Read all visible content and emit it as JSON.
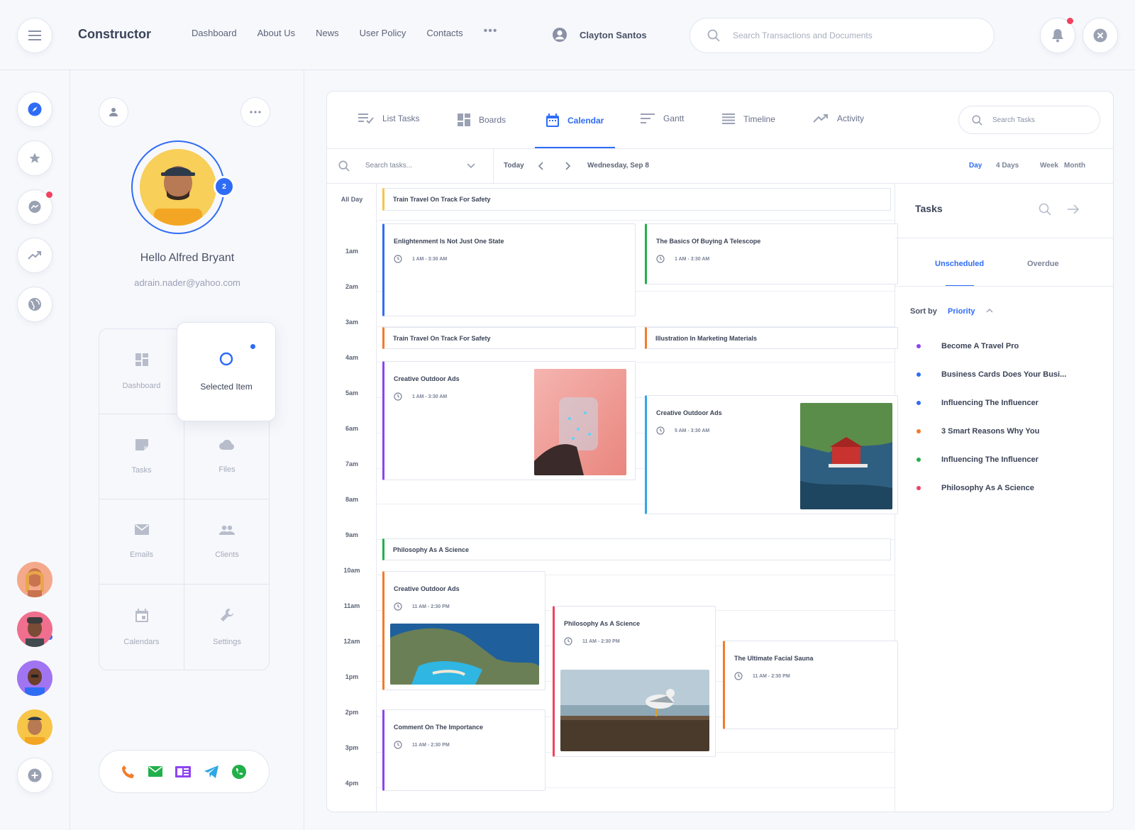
{
  "topbar": {
    "brand": "Constructor",
    "nav": [
      "Dashboard",
      "About Us",
      "News",
      "User Policy",
      "Contacts"
    ],
    "nav_more": "•••",
    "user_name": "Clayton Santos",
    "search_placeholder": "Search Transactions and Documents"
  },
  "profile": {
    "greeting": "Hello Alfred Bryant",
    "email": "adrain.nader@yahoo.com",
    "badge_count": "2",
    "menu": {
      "dashboard": "Dashboard",
      "selected": "Selected Item",
      "tasks": "Tasks",
      "files": "Files",
      "emails": "Emails",
      "clients": "Clients",
      "calendars": "Calendars",
      "settings": "Settings"
    }
  },
  "tabs": {
    "list_tasks": "List Tasks",
    "boards": "Boards",
    "calendar": "Calendar",
    "gantt": "Gantt",
    "timeline": "Timeline",
    "activity": "Activity",
    "search_placeholder": "Search Tasks"
  },
  "toolbar": {
    "search_placeholder": "Search tasks...",
    "today": "Today",
    "date": "Wednesday, Sep 8",
    "views": {
      "day": "Day",
      "four_days": "4 Days",
      "week": "Week",
      "month": "Month"
    }
  },
  "calendar": {
    "all_day_label": "All Day",
    "hours": [
      "1am",
      "2am",
      "3am",
      "4am",
      "5am",
      "6am",
      "7am",
      "8am",
      "9am",
      "10am",
      "11am",
      "12am",
      "1pm",
      "2pm",
      "3pm",
      "4pm"
    ],
    "all_day_event": "Train Travel On Track For Safety",
    "events": {
      "e1": {
        "title": "Enlightenment Is Not Just One State",
        "time": "1 AM - 3:30 AM"
      },
      "e2": {
        "title": "The Basics Of Buying A Telescope",
        "time": "1 AM - 3:30 AM"
      },
      "e3": {
        "title": "Train Travel On Track For Safety"
      },
      "e4": {
        "title": "Illustration In Marketing Materials"
      },
      "e5": {
        "title": "Creative Outdoor Ads",
        "time": "1 AM - 3:30 AM"
      },
      "e6": {
        "title": "Creative Outdoor Ads",
        "time": "5 AM - 3:30 AM"
      },
      "e7": {
        "title": "Philosophy As A Science"
      },
      "e8": {
        "title": "Creative Outdoor Ads",
        "time": "11 AM - 2:30 PM"
      },
      "e9": {
        "title": "Philosophy As A Science",
        "time": "11 AM - 2:30 PM"
      },
      "e10": {
        "title": "The Ultimate Facial Sauna",
        "time": "11 AM - 2:30 PM"
      },
      "e11": {
        "title": "Comment On The Importance",
        "time": "11 AM - 2:30 PM"
      }
    }
  },
  "tasks_panel": {
    "title": "Tasks",
    "tab_unscheduled": "Unscheduled",
    "tab_overdue": "Overdue",
    "sort_by": "Sort by",
    "sort_value": "Priority",
    "items": [
      {
        "label": "Become A Travel Pro",
        "color": "#8e44ef"
      },
      {
        "label": "Business Cards Does Your Busi...",
        "color": "#2f6cf6"
      },
      {
        "label": "Influencing The Influencer",
        "color": "#2f6cf6"
      },
      {
        "label": "3 Smart Reasons Why You",
        "color": "#f47a2a"
      },
      {
        "label": "Influencing The Influencer",
        "color": "#22b04b"
      },
      {
        "label": "Philosophy As A Science",
        "color": "#f2415f"
      }
    ]
  },
  "colors": {
    "accent": "#2f6cf6",
    "notification": "#f2415f"
  }
}
